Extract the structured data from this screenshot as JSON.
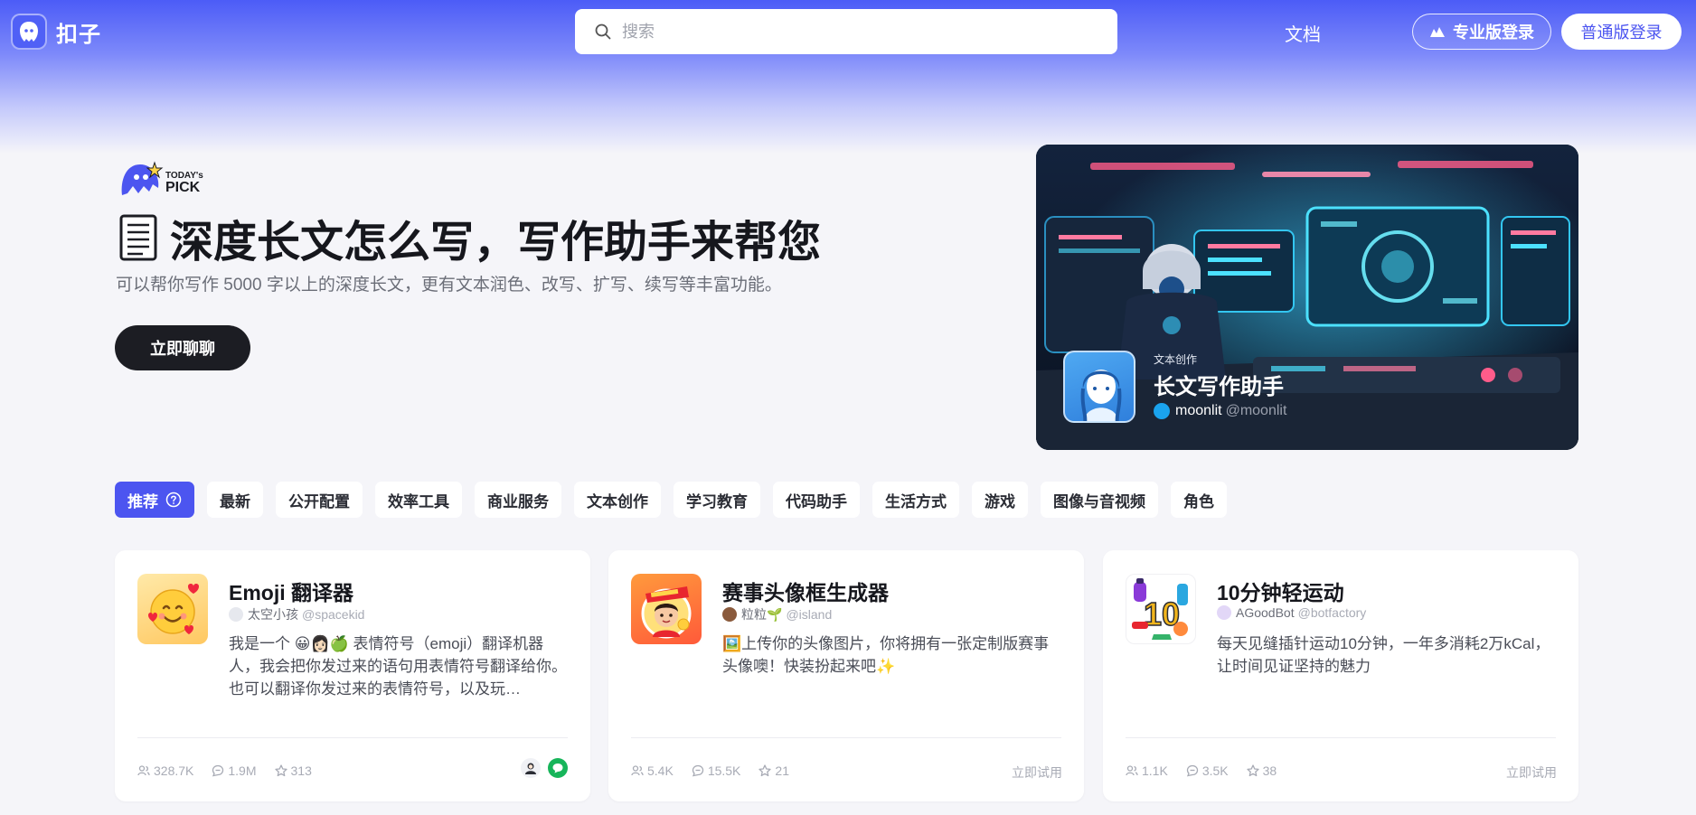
{
  "header": {
    "brand": "扣子",
    "search_placeholder": "搜索",
    "docs_link": "文档",
    "pro_login": "专业版登录",
    "normal_login": "普通版登录"
  },
  "hero": {
    "pick_small": "TODAY's",
    "pick_big": "PICK",
    "title": "深度长文怎么写，写作助手来帮您",
    "subtitle": "可以帮你写作 5000 字以上的深度长文，更有文本润色、改写、扩写、续写等丰富功能。",
    "cta": "立即聊聊",
    "card": {
      "category": "文本创作",
      "name": "长文写作助手",
      "author": "moonlit",
      "handle": "@moonlit"
    }
  },
  "tabs": [
    {
      "label": "推荐",
      "active": true
    },
    {
      "label": "最新"
    },
    {
      "label": "公开配置"
    },
    {
      "label": "效率工具"
    },
    {
      "label": "商业服务"
    },
    {
      "label": "文本创作"
    },
    {
      "label": "学习教育"
    },
    {
      "label": "代码助手"
    },
    {
      "label": "生活方式"
    },
    {
      "label": "游戏"
    },
    {
      "label": "图像与音视频"
    },
    {
      "label": "角色"
    }
  ],
  "cards": [
    {
      "title": "Emoji 翻译器",
      "author": "太空小孩",
      "handle": "@spacekid",
      "description": "我是一个 😀👩🏻🍏 表情符号（emoji）翻译机器人，我会把你发过来的语句用表情符号翻译给你。也可以翻译你发过来的表情符号，以及玩…",
      "users": "328.7K",
      "chats": "1.9M",
      "favorites": "313"
    },
    {
      "title": "赛事头像框生成器",
      "author": "粒粒🌱",
      "handle": "@island",
      "description": "🖼️上传你的头像图片，你将拥有一张定制版赛事头像噢！快装扮起来吧✨",
      "users": "5.4K",
      "chats": "15.5K",
      "favorites": "21",
      "try_label": "立即试用"
    },
    {
      "title": "10分钟轻运动",
      "author": "AGoodBot",
      "handle": "@botfactory",
      "description": "每天见缝插针运动10分钟，一年多消耗2万kCal，让时间见证坚持的魅力",
      "users": "1.1K",
      "chats": "3.5K",
      "favorites": "38",
      "try_label": "立即试用"
    }
  ],
  "colors": {
    "accent": "#4c55f0",
    "header_blue": "#4c5cf7",
    "dark_button": "#1c1d23"
  }
}
